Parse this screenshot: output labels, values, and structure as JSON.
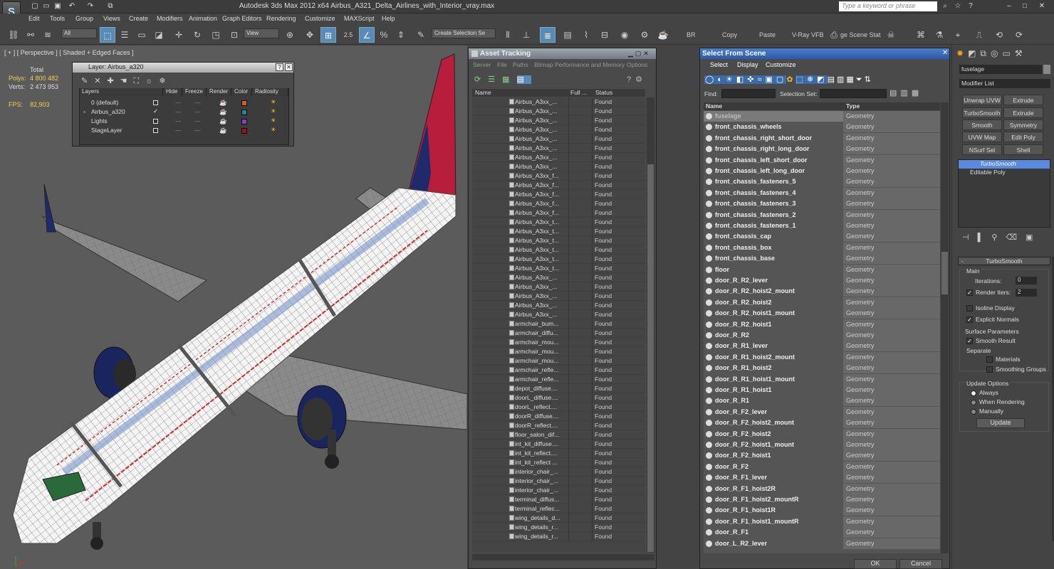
{
  "window": {
    "logo": "S",
    "title": "Autodesk 3ds Max  2012 x64      Airbus_A321_Delta_Airlines_with_Interior_vray.max",
    "search_placeholder": "Type a keyword or phrase",
    "controls": [
      "⌕",
      "☆",
      "?",
      "–",
      "□",
      "✕"
    ]
  },
  "menu": [
    "Edit",
    "Tools",
    "Group",
    "Views",
    "Create",
    "Modifiers",
    "Animation",
    "Graph Editors",
    "Rendering",
    "Customize",
    "MAXScript",
    "Help"
  ],
  "toolbar": {
    "filter": "All",
    "coord": "View",
    "selset": "Create Selection Se",
    "snap": "2.5",
    "percent": "%",
    "labels": [
      "BR",
      "Copy",
      "Paste",
      "V-Ray VFB",
      "ge Scene Stat"
    ]
  },
  "viewport": {
    "label": "[ + ] [ Perspective ] [ Shaded + Edged Faces ]",
    "total": "Total",
    "polys_label": "Polys:",
    "polys": "4 800 482",
    "verts_label": "Verts:",
    "verts": "2 473 953",
    "fps_label": "FPS:",
    "fps": "82,903"
  },
  "layer_dialog": {
    "title": "Layer: Airbus_a320",
    "headers": [
      "Layers",
      "Hide",
      "Freeze",
      "Render",
      "Color",
      "Radiosity"
    ],
    "rows": [
      {
        "name": "0 (default)",
        "color": "#d86010"
      },
      {
        "name": "Airbus_a320",
        "color": "#1a8a9a"
      },
      {
        "name": "Lights",
        "color": "#8840c0"
      },
      {
        "name": "StageLayer",
        "color": "#a01010"
      }
    ]
  },
  "asset": {
    "title": "Asset Tracking",
    "menu": [
      "Server",
      "File",
      "Paths",
      "Bitmap Performance and Memory",
      "Options"
    ],
    "headers": [
      "Name",
      "Full ...",
      "Status"
    ],
    "status": "Found",
    "rows": [
      "Airbus_A3xx_...",
      "Airbus_A3xx_...",
      "Airbus_A3xx_...",
      "Airbus_A3xx_...",
      "Airbus_A3xx_...",
      "Airbus_A3xx_...",
      "Airbus_A3xx_...",
      "Airbus_A3xx_...",
      "Airbus_A3xx_f...",
      "Airbus_A3xx_f...",
      "Airbus_A3xx_f...",
      "Airbus_A3xx_f...",
      "Airbus_A3xx_f...",
      "Airbus_A3xx_t...",
      "Airbus_A3xx_t...",
      "Airbus_A3xx_t...",
      "Airbus_A3xx_t...",
      "Airbus_A3xx_t...",
      "Airbus_A3xx_t...",
      "Airbus_A3xx_...",
      "Airbus_A3xx_...",
      "Airbus_A3xx_...",
      "Airbus_A3xx_...",
      "Airbus_A3xx_...",
      "armchair_bum...",
      "armchair_diffu...",
      "armchair_mou...",
      "armchair_mou...",
      "armchair_mou...",
      "armchair_refle...",
      "armchair_refle...",
      "depot_diffuse....",
      "doorL_diffuse....",
      "doorL_reflect....",
      "doorR_diffuse....",
      "doorR_reflect....",
      "floor_salon_dif...",
      "int_kit_diffuse....",
      "int_kit_reflect....",
      "int_kit_reflect ...",
      "interior_chair_...",
      "interior_chair_...",
      "interior_chair_...",
      "terminal_diffus...",
      "terminal_reflec...",
      "wing_details_d...",
      "wing_details_r...",
      "wing_details_r..."
    ]
  },
  "scene": {
    "title": "Select From Scene",
    "menu": [
      "Select",
      "Display",
      "Customize"
    ],
    "find_label": "Find:",
    "selset_label": "Selection Set:",
    "headers": [
      "Name",
      "Type"
    ],
    "type": "Geometry",
    "ok": "OK",
    "cancel": "Cancel",
    "rows": [
      "fuselage",
      "front_chassis_wheels",
      "front_chassis_right_short_door",
      "front_chassis_right_long_door",
      "front_chassis_left_short_door",
      "front_chassis_left_long_door",
      "front_chassis_fasteners_5",
      "front_chassis_fasteners_4",
      "front_chassis_fasteners_3",
      "front_chassis_fasteners_2",
      "front_chassis_fasteners_1",
      "front_chassis_cap",
      "front_chassis_box",
      "front_chassis_base",
      "floor",
      "door_R_R2_lever",
      "door_R_R2_hoist2_mount",
      "door_R_R2_hoist2",
      "door_R_R2_hoist1_mount",
      "door_R_R2_hoist1",
      "door_R_R2",
      "door_R_R1_lever",
      "door_R_R1_hoist2_mount",
      "door_R_R1_hoist2",
      "door_R_R1_hoist1_mount",
      "door_R_R1_hoist1",
      "door_R_R1",
      "door_R_F2_lever",
      "door_R_F2_hoist2_mount",
      "door_R_F2_hoist2",
      "door_R_F2_hoist1_mount",
      "door_R_F2_hoist1",
      "door_R_F2",
      "door_R_F1_lever",
      "door_R_F1_hoist2R",
      "door_R_F1_hoist2_mountR",
      "door_R_F1_hoist1R",
      "door_R_F1_hoist1_mountR",
      "door_R_F1",
      "door_L_R2_lever"
    ]
  },
  "command": {
    "object_name": "fuselage",
    "modifier_list": "Modifier List",
    "buttons": [
      "Unwrap UVW",
      "Extrude",
      "TurboSmooth",
      "Extrude",
      "Smooth",
      "Symmetry",
      "UVW Map",
      "Edit Poly",
      "NSurf Sel",
      "Shell"
    ],
    "stack": [
      "TurboSmooth",
      "Editable Poly"
    ],
    "rollout": {
      "title": "TurboSmooth",
      "main": "Main",
      "iterations_label": "Iterations:",
      "iterations": "0",
      "render_iters_label": "Render Iters:",
      "render_iters": "2",
      "isoline": "Isoline Display",
      "explicit": "Explicit Normals",
      "surface": "Surface Parameters",
      "smooth_result": "Smooth Result",
      "separate": "Separate",
      "materials": "Materials",
      "smoothing_groups": "Smoothing Groups",
      "update_options": "Update Options",
      "always": "Always",
      "when_rendering": "When Rendering",
      "manually": "Manually",
      "update": "Update"
    }
  }
}
